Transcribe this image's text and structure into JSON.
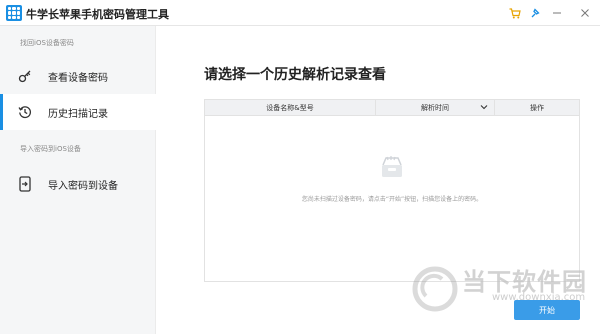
{
  "app": {
    "title": "牛学长苹果手机密码管理工具",
    "icons": {
      "logo": "grid-logo-icon",
      "cart": "cart-icon",
      "pin": "pin-icon",
      "minimize": "minimize-icon",
      "close": "close-icon"
    },
    "accent_color": "#1a8fe3"
  },
  "sidebar": {
    "section_find": "找回iOS设备密码",
    "section_import": "导入密码到iOS设备",
    "items": [
      {
        "label": "查看设备密码",
        "icon": "key-icon",
        "active": false
      },
      {
        "label": "历史扫描记录",
        "icon": "history-icon",
        "active": true
      },
      {
        "label": "导入密码到设备",
        "icon": "import-device-icon",
        "active": false
      }
    ]
  },
  "main": {
    "title": "请选择一个历史解析记录查看",
    "table": {
      "columns": [
        "设备名称&型号",
        "解析时间",
        "操作"
      ],
      "empty_icon": "empty-tray-icon",
      "empty_text": "您尚未扫描过设备密码，请点击“开始”按钮，扫描您设备上的密码。"
    },
    "start_button": "开始"
  },
  "watermark": {
    "text": "当下软件园",
    "url": "www.downxia.com"
  }
}
